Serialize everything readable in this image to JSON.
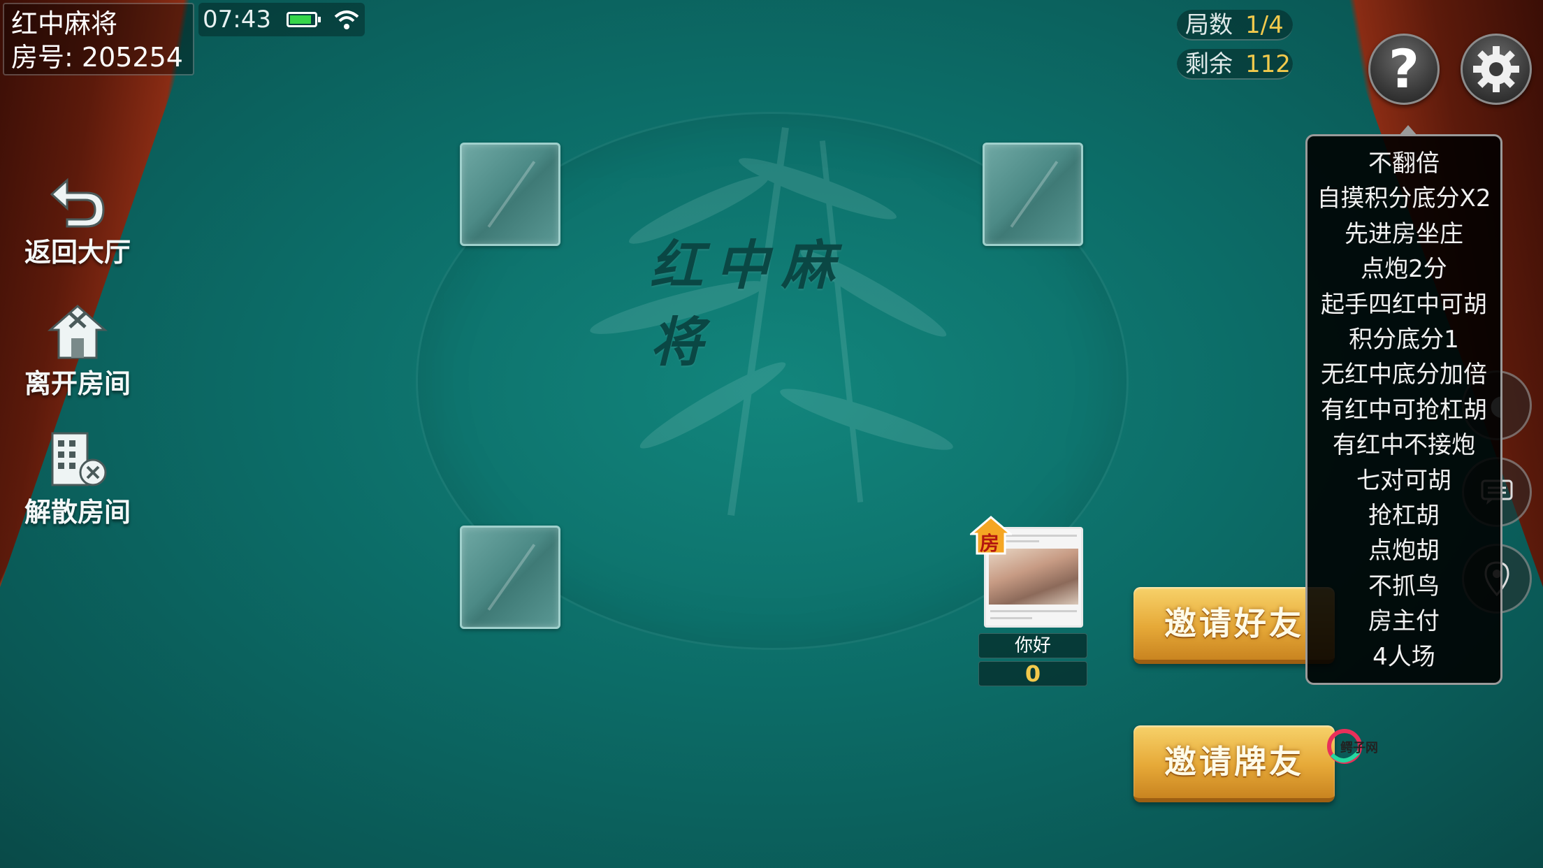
{
  "game_title": "红中麻将",
  "room": {
    "label": "房号:",
    "number": "205254"
  },
  "status": {
    "time": "07:43"
  },
  "side_menu": [
    {
      "label": "返回大厅",
      "icon": "back-arrow-icon"
    },
    {
      "label": "离开房间",
      "icon": "house-exit-icon"
    },
    {
      "label": "解散房间",
      "icon": "building-dismiss-icon"
    }
  ],
  "counters": {
    "rounds_label": "局数",
    "rounds_value": "1/4",
    "remaining_label": "剩余",
    "remaining_value": "112"
  },
  "table_title": "红中麻将",
  "player": {
    "host_badge": "房",
    "name": "你好",
    "score": "0"
  },
  "buttons": {
    "invite_friends": "邀请好友",
    "invite_players": "邀请牌友"
  },
  "rules": [
    "不翻倍",
    "自摸积分底分X2",
    "先进房坐庄",
    "点炮2分",
    "起手四红中可胡",
    "积分底分1",
    "无红中底分加倍",
    "有红中可抢杠胡",
    "有红中不接炮",
    "七对可胡",
    "抢杠胡",
    "点炮胡",
    "不抓鸟",
    "房主付",
    "4人场"
  ],
  "watermark": "鳄子网",
  "colors": {
    "felt": "#0c6c67",
    "gold": "#f2c94c",
    "button": "#e6a938"
  }
}
